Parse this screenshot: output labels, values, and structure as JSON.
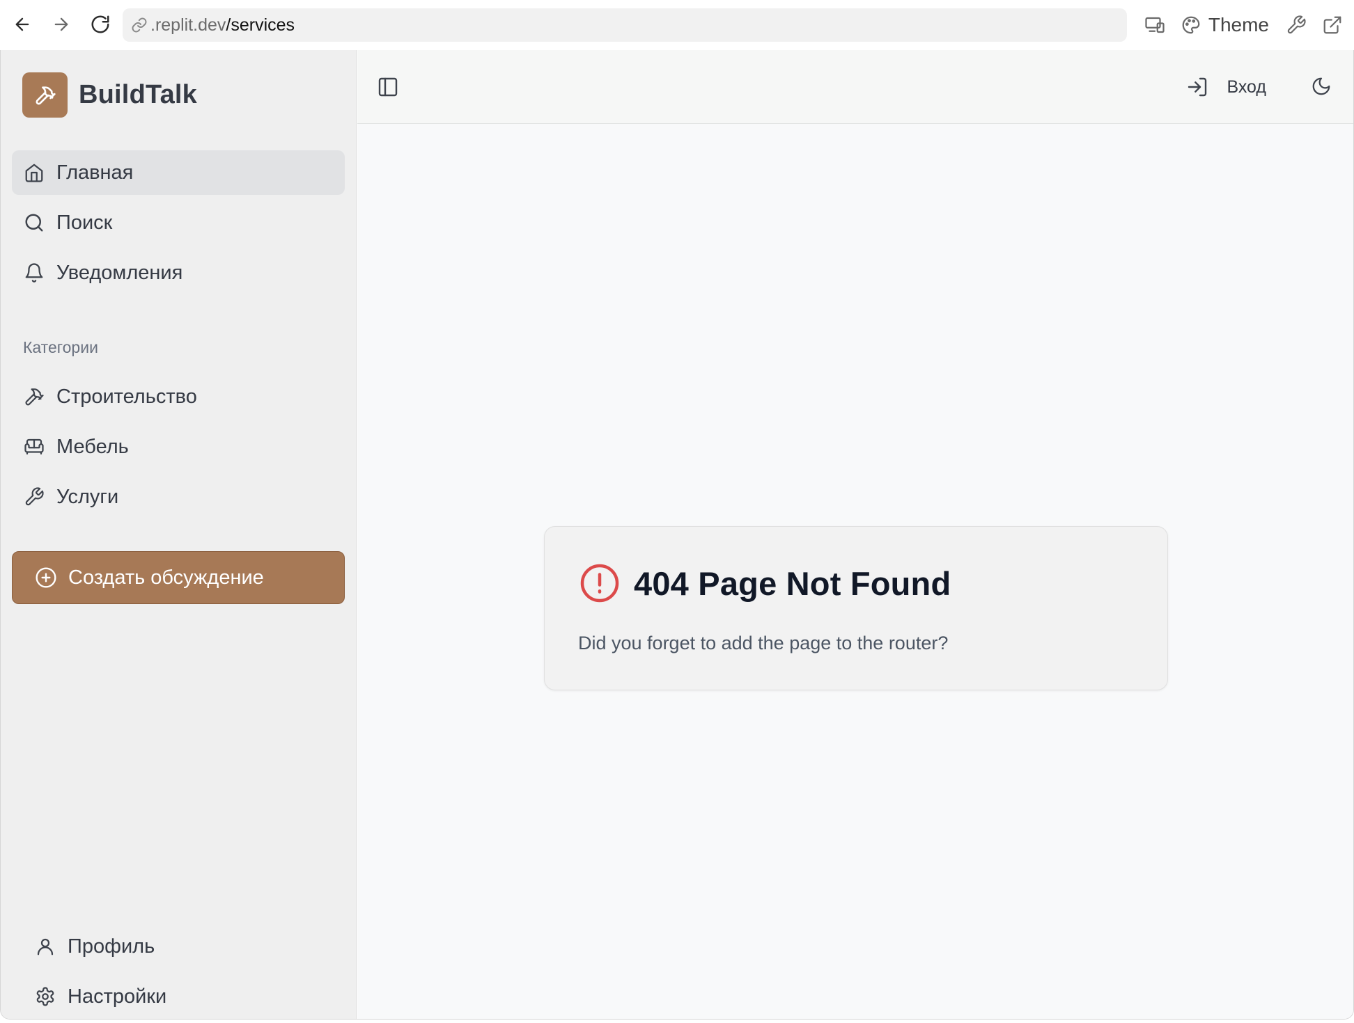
{
  "browser": {
    "url_host": ".replit.dev",
    "url_path": "/services",
    "theme_label": "Theme"
  },
  "sidebar": {
    "brand": "BuildTalk",
    "nav": [
      {
        "label": "Главная",
        "icon": "home-icon",
        "active": true
      },
      {
        "label": "Поиск",
        "icon": "search-icon",
        "active": false
      },
      {
        "label": "Уведомления",
        "icon": "bell-icon",
        "active": false
      }
    ],
    "categories_title": "Категории",
    "categories": [
      {
        "label": "Строительство",
        "icon": "hammer-icon"
      },
      {
        "label": "Мебель",
        "icon": "sofa-icon"
      },
      {
        "label": "Услуги",
        "icon": "wrench-icon"
      }
    ],
    "create_label": "Создать обсуждение",
    "bottom": [
      {
        "label": "Профиль",
        "icon": "user-icon"
      },
      {
        "label": "Настройки",
        "icon": "settings-icon"
      }
    ]
  },
  "topbar": {
    "login_label": "Вход"
  },
  "error_card": {
    "title": "404 Page Not Found",
    "message": "Did you forget to add the page to the router?"
  },
  "colors": {
    "accent": "#a77956",
    "error": "#dc4a4a"
  }
}
